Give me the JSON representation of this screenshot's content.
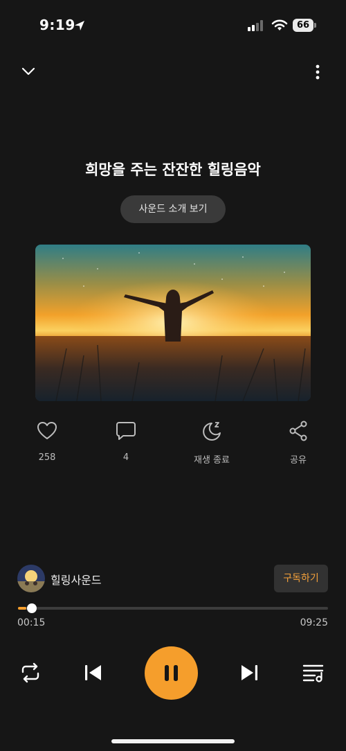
{
  "status_bar": {
    "time": "9:19",
    "battery": "66"
  },
  "header": {
    "collapse_icon": "chevron-down-icon",
    "more_icon": "more-vertical-icon"
  },
  "track": {
    "title": "희망을 주는 잔잔한 힐링음악",
    "intro_label": "사운드 소개 보기"
  },
  "actions": [
    {
      "icon": "heart-icon",
      "label": "258"
    },
    {
      "icon": "comment-icon",
      "label": "4"
    },
    {
      "icon": "sleep-timer-icon",
      "label": "재생 종료"
    },
    {
      "icon": "share-icon",
      "label": "공유"
    }
  ],
  "channel": {
    "name": "힐링사운드",
    "subscribe_label": "구독하기"
  },
  "progress": {
    "current": "00:15",
    "total": "09:25",
    "fraction": 0.027
  },
  "colors": {
    "accent": "#f59e2c",
    "background": "#161616"
  },
  "controls": [
    "repeat-icon",
    "previous-icon",
    "pause-icon",
    "next-icon",
    "queue-icon"
  ]
}
